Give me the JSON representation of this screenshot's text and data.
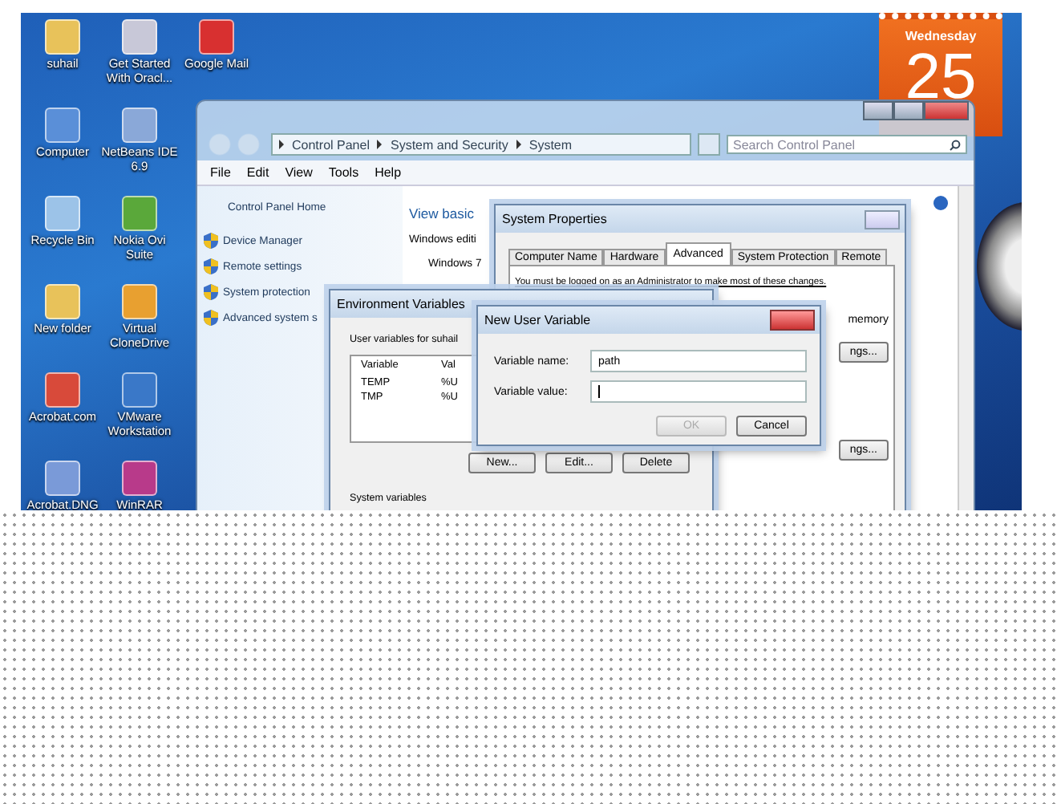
{
  "desktop": {
    "icons": [
      {
        "label": "suhail"
      },
      {
        "label": "Computer"
      },
      {
        "label": "Recycle Bin"
      },
      {
        "label": "New folder"
      },
      {
        "label": "Acrobat.com"
      },
      {
        "label": "Acrobat.DNG"
      },
      {
        "label": "Get Started With Oracl..."
      },
      {
        "label": "NetBeans IDE 6.9"
      },
      {
        "label": "Nokia Ovi Suite"
      },
      {
        "label": "Virtual CloneDrive"
      },
      {
        "label": "VMware Workstation"
      },
      {
        "label": "WinRAR"
      },
      {
        "label": "Google Mail"
      }
    ]
  },
  "calendar_gadget": {
    "weekday": "Wednesday",
    "day": "25"
  },
  "control_panel": {
    "breadcrumb": [
      "Control Panel",
      "System and Security",
      "System"
    ],
    "search": {
      "placeholder": "Search Control Panel"
    },
    "menu": [
      "File",
      "Edit",
      "View",
      "Tools",
      "Help"
    ],
    "left_pane": {
      "home": "Control Panel Home",
      "tasks": [
        "Device Manager",
        "Remote settings",
        "System protection",
        "Advanced system s"
      ]
    },
    "main": {
      "heading": "View basic",
      "lines": [
        "Windows editi",
        "Windows 7"
      ]
    }
  },
  "system_properties": {
    "title": "System Properties",
    "tabs": [
      {
        "label": "Computer Name",
        "selected": false
      },
      {
        "label": "Hardware",
        "selected": false
      },
      {
        "label": "Advanced",
        "selected": true
      },
      {
        "label": "System Protection",
        "selected": false
      },
      {
        "label": "Remote",
        "selected": false
      }
    ],
    "notice": "You must be logged on as an Administrator to make most of these changes.",
    "side_text": "memory",
    "buttons": [
      "ngs...",
      "ngs..."
    ]
  },
  "environment_variables": {
    "title": "Environment Variables",
    "user_label": "User variables for suhail",
    "columns": [
      "Variable",
      "Val"
    ],
    "rows": [
      {
        "name": "TEMP",
        "value": "%U",
        "selected": false
      },
      {
        "name": "TMP",
        "value": "%U",
        "selected": false
      }
    ],
    "buttons": [
      "New...",
      "Edit...",
      "Delete"
    ],
    "system_label": "System variables"
  },
  "new_user_variable": {
    "title": "New User Variable",
    "fields": [
      {
        "label": "Variable name:",
        "value": "path",
        "focused": false
      },
      {
        "label": "Variable value:",
        "focused": true
      }
    ],
    "buttons": [
      {
        "label": "OK",
        "disabled": true
      },
      {
        "label": "Cancel",
        "disabled": false
      }
    ]
  }
}
